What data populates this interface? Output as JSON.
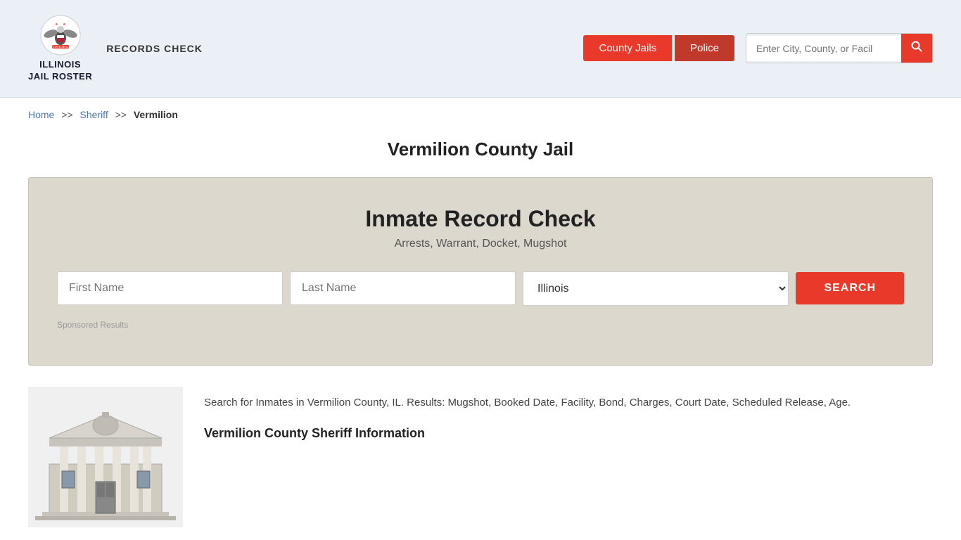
{
  "header": {
    "logo_line1": "ILLINOIS",
    "logo_line2": "JAIL ROSTER",
    "records_check_label": "RECORDS CHECK",
    "btn_county_jails": "County Jails",
    "btn_police": "Police",
    "search_placeholder": "Enter City, County, or Facil"
  },
  "breadcrumb": {
    "home": "Home",
    "sheriff": "Sheriff",
    "current": "Vermilion",
    "sep": ">>"
  },
  "page_title": "Vermilion County Jail",
  "search_panel": {
    "title": "Inmate Record Check",
    "subtitle": "Arrests, Warrant, Docket, Mugshot",
    "first_name_placeholder": "First Name",
    "last_name_placeholder": "Last Name",
    "state_default": "Illinois",
    "search_button": "SEARCH",
    "sponsored_label": "Sponsored Results"
  },
  "bottom": {
    "description": "Search for Inmates in Vermilion County, IL. Results: Mugshot, Booked Date, Facility, Bond, Charges, Court Date, Scheduled Release, Age.",
    "sheriff_heading": "Vermilion County Sheriff Information"
  }
}
